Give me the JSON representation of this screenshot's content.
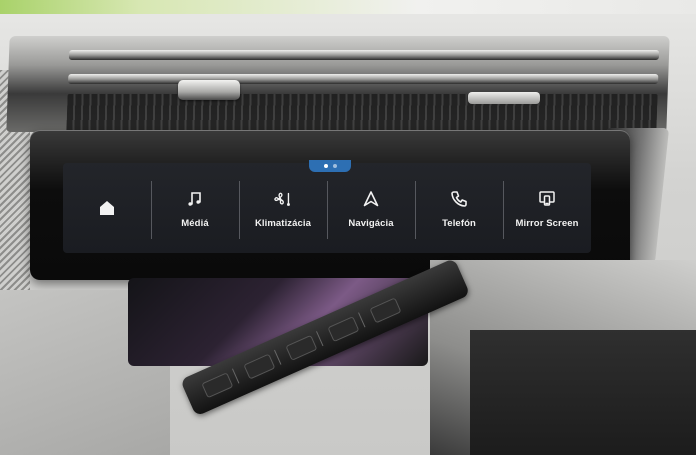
{
  "screen": {
    "tiles": [
      {
        "id": "home",
        "icon": "home-icon",
        "label": ""
      },
      {
        "id": "media",
        "icon": "music-note-icon",
        "label": "Médiá"
      },
      {
        "id": "climate",
        "icon": "fan-climate-icon",
        "label": "Klimatizácia"
      },
      {
        "id": "navigation",
        "icon": "navigation-arrow-icon",
        "label": "Navigácia"
      },
      {
        "id": "phone",
        "icon": "phone-icon",
        "label": "Telefón"
      },
      {
        "id": "mirror",
        "icon": "mirror-screen-icon",
        "label": "Mirror Screen"
      }
    ],
    "page_indicator": {
      "pages": 2,
      "current": 1
    }
  },
  "colors": {
    "screen_background": "#1f2126",
    "label_text": "#f2f2f2",
    "accent": "#2d6fb3",
    "divider": "#56585e"
  }
}
